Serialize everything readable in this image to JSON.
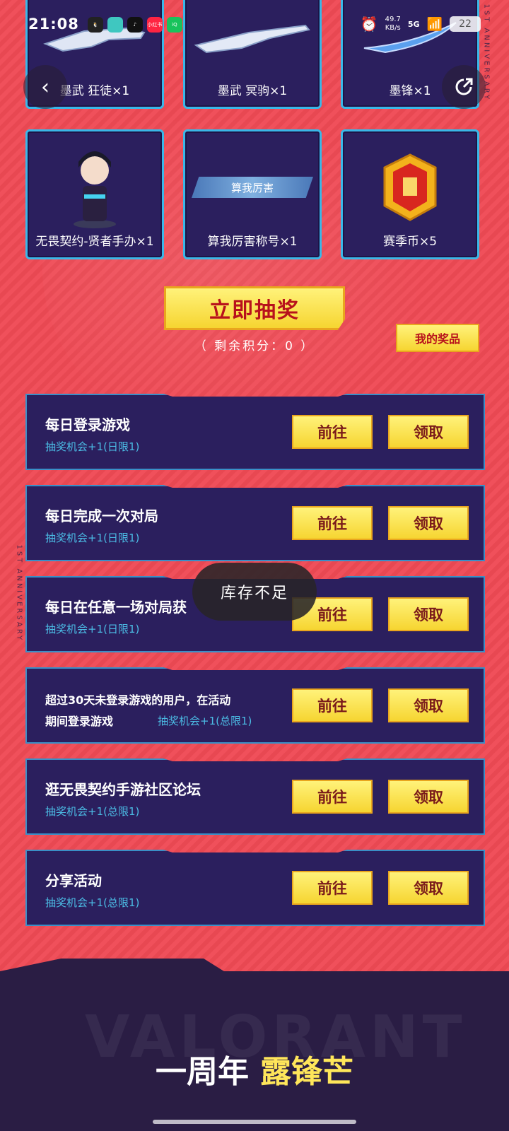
{
  "status_bar": {
    "time": "21:08",
    "apps": [
      "QQ",
      "app",
      "TikTok",
      "小红书",
      "iQIYI 爱奇艺"
    ],
    "net_speed_value": "49.7",
    "net_speed_unit": "KB/s",
    "signal": "5G",
    "battery": "22"
  },
  "nav": {
    "back_icon": "chevron-left-icon",
    "share_icon": "share-icon"
  },
  "prizes_row1": [
    {
      "label": "墨武 狂徒×1"
    },
    {
      "label": "墨武 冥驹×1"
    },
    {
      "label": "墨锋×1"
    }
  ],
  "prizes_row2": [
    {
      "label": "无畏契约-贤者手办×1"
    },
    {
      "label": "算我厉害称号×1",
      "banner": "算我厉害"
    },
    {
      "label": "赛季币×5"
    }
  ],
  "draw": {
    "button": "立即抽奖",
    "points_text": "（ 剩余积分：0 ）",
    "my_prizes": "我的奖品"
  },
  "tasks": [
    {
      "title": "每日登录游戏",
      "reward": "抽奖机会+1(日限1)",
      "go": "前往",
      "claim": "领取"
    },
    {
      "title": "每日完成一次对局",
      "reward": "抽奖机会+1(日限1)",
      "go": "前往",
      "claim": "领取"
    },
    {
      "title": "每日在任意一场对局获",
      "reward": "抽奖机会+1(日限1)",
      "go": "前往",
      "claim": "领取"
    },
    {
      "title_line1": "超过30天未登录游戏的用户，在活动",
      "title_line2": "期间登录游戏",
      "reward": "抽奖机会+1(总限1)",
      "go": "前往",
      "claim": "领取"
    },
    {
      "title": "逛无畏契约手游社区论坛",
      "reward": "抽奖机会+1(总限1)",
      "go": "前往",
      "claim": "领取"
    },
    {
      "title": "分享活动",
      "reward": "抽奖机会+1(总限1)",
      "go": "前往",
      "claim": "领取"
    }
  ],
  "toast": "库存不足",
  "side_text": "1ST ANNIVERSARY",
  "footer": {
    "title_a": "一周年",
    "title_b": "露锋芒",
    "bg_word": "VALORANT"
  }
}
